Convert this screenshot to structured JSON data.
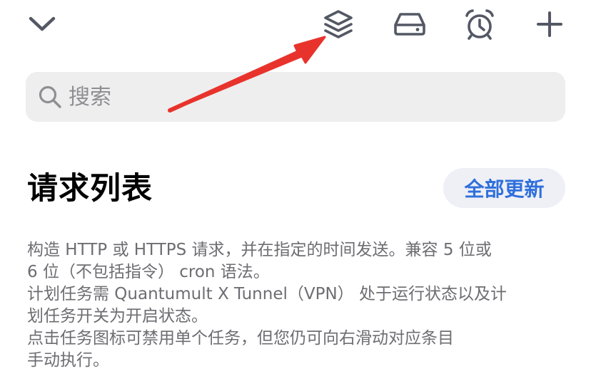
{
  "toolbar": {
    "buttons": [
      {
        "icon": "chevron-down-icon"
      },
      {
        "icon": "layers-icon"
      },
      {
        "icon": "drive-icon"
      },
      {
        "icon": "alarm-clock-icon"
      },
      {
        "icon": "plus-icon"
      }
    ],
    "icon_color": "#545865"
  },
  "search": {
    "placeholder": "搜索",
    "value": ""
  },
  "section": {
    "title": "请求列表",
    "update_button_label": "全部更新"
  },
  "description": {
    "line1": "构造 HTTP 或 HTTPS 请求，并在指定的时间发送。兼容 5 位或\n6 位（不包括指令） cron 语法。",
    "line2": "计划任务需 Quantumult X Tunnel（VPN） 处于运行状态以及计\n划任务开关为开启状态。",
    "line3": "点击任务图标可禁用单个任务，但您仍可向右滑动对应条目\n手动执行。"
  },
  "colors": {
    "accent": "#2f6fdc",
    "annotation_arrow": "#e8332c",
    "search_background": "#eeeeef",
    "secondary_text": "#6d6d72"
  }
}
